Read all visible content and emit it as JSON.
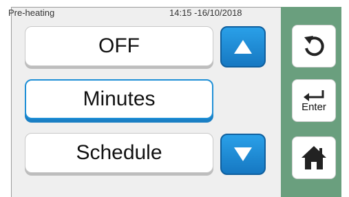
{
  "status": {
    "title": "Pre-heating",
    "datetime": "14:15 -16/10/2018"
  },
  "options": [
    {
      "label": "OFF",
      "selected": false
    },
    {
      "label": "Minutes",
      "selected": true
    },
    {
      "label": "Schedule",
      "selected": false
    }
  ],
  "buttons": {
    "up_icon": "arrow-up-icon",
    "down_icon": "arrow-down-icon",
    "back_icon": "undo-icon",
    "enter_label": "Enter",
    "home_icon": "home-icon"
  },
  "colors": {
    "accent": "#1f8fd6",
    "side_panel": "#6a9f7e",
    "background": "#efefef"
  }
}
